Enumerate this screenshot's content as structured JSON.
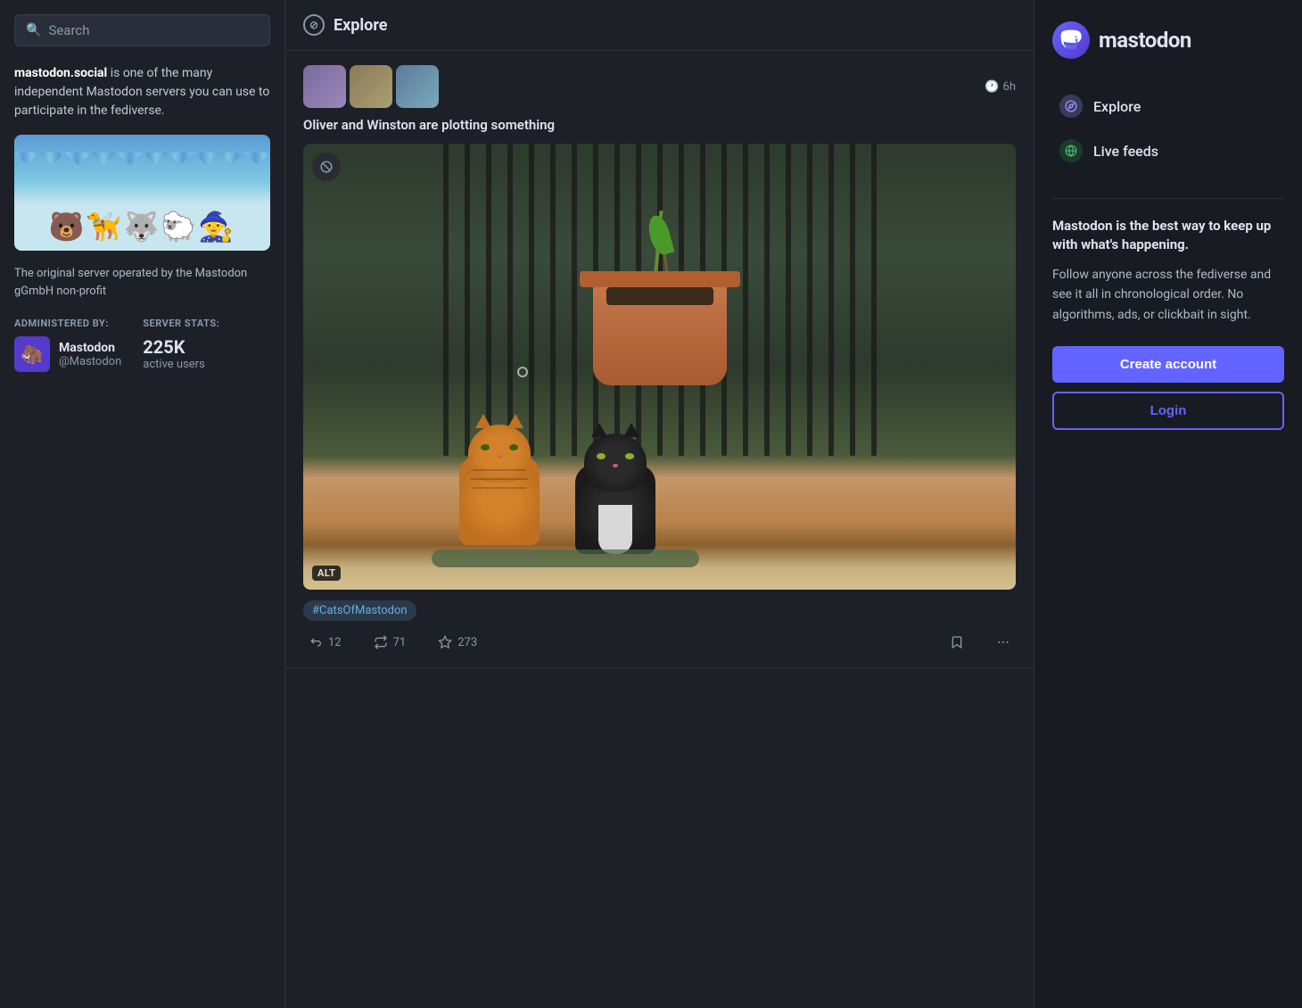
{
  "left_sidebar": {
    "search_placeholder": "Search",
    "description_bold": "mastodon.social",
    "description_rest": " is one of the many independent Mastodon servers you can use to participate in the fediverse.",
    "about_text": "The original server operated by the Mastodon gGmbH non-profit",
    "admin_label": "ADMINISTERED BY:",
    "stats_label": "SERVER STATS:",
    "admin_name": "Mastodon",
    "admin_handle": "@Mastodon",
    "stats_number": "225K",
    "stats_users_label": "active users"
  },
  "main_feed": {
    "header_label": "Explore",
    "post": {
      "time": "6h",
      "title": "Oliver and Winston are plotting something",
      "hashtag": "#CatsOfMastodon",
      "alt_badge": "ALT",
      "actions": {
        "reply_count": "12",
        "boost_count": "71",
        "favorite_count": "273",
        "reply_label": "12",
        "boost_label": "71",
        "favorite_label": "273"
      }
    }
  },
  "right_sidebar": {
    "logo_text": "mastodon",
    "logo_icon_char": "m",
    "nav": [
      {
        "label": "Explore",
        "icon_type": "explore"
      },
      {
        "label": "Live feeds",
        "icon_type": "live"
      }
    ],
    "tagline_bold": "Mastodon is the best way to keep up with what's happening.",
    "tagline_normal": "Follow anyone across the fediverse and see it all in chronological order. No algorithms, ads, or clickbait in sight.",
    "create_account_label": "Create account",
    "login_label": "Login"
  }
}
